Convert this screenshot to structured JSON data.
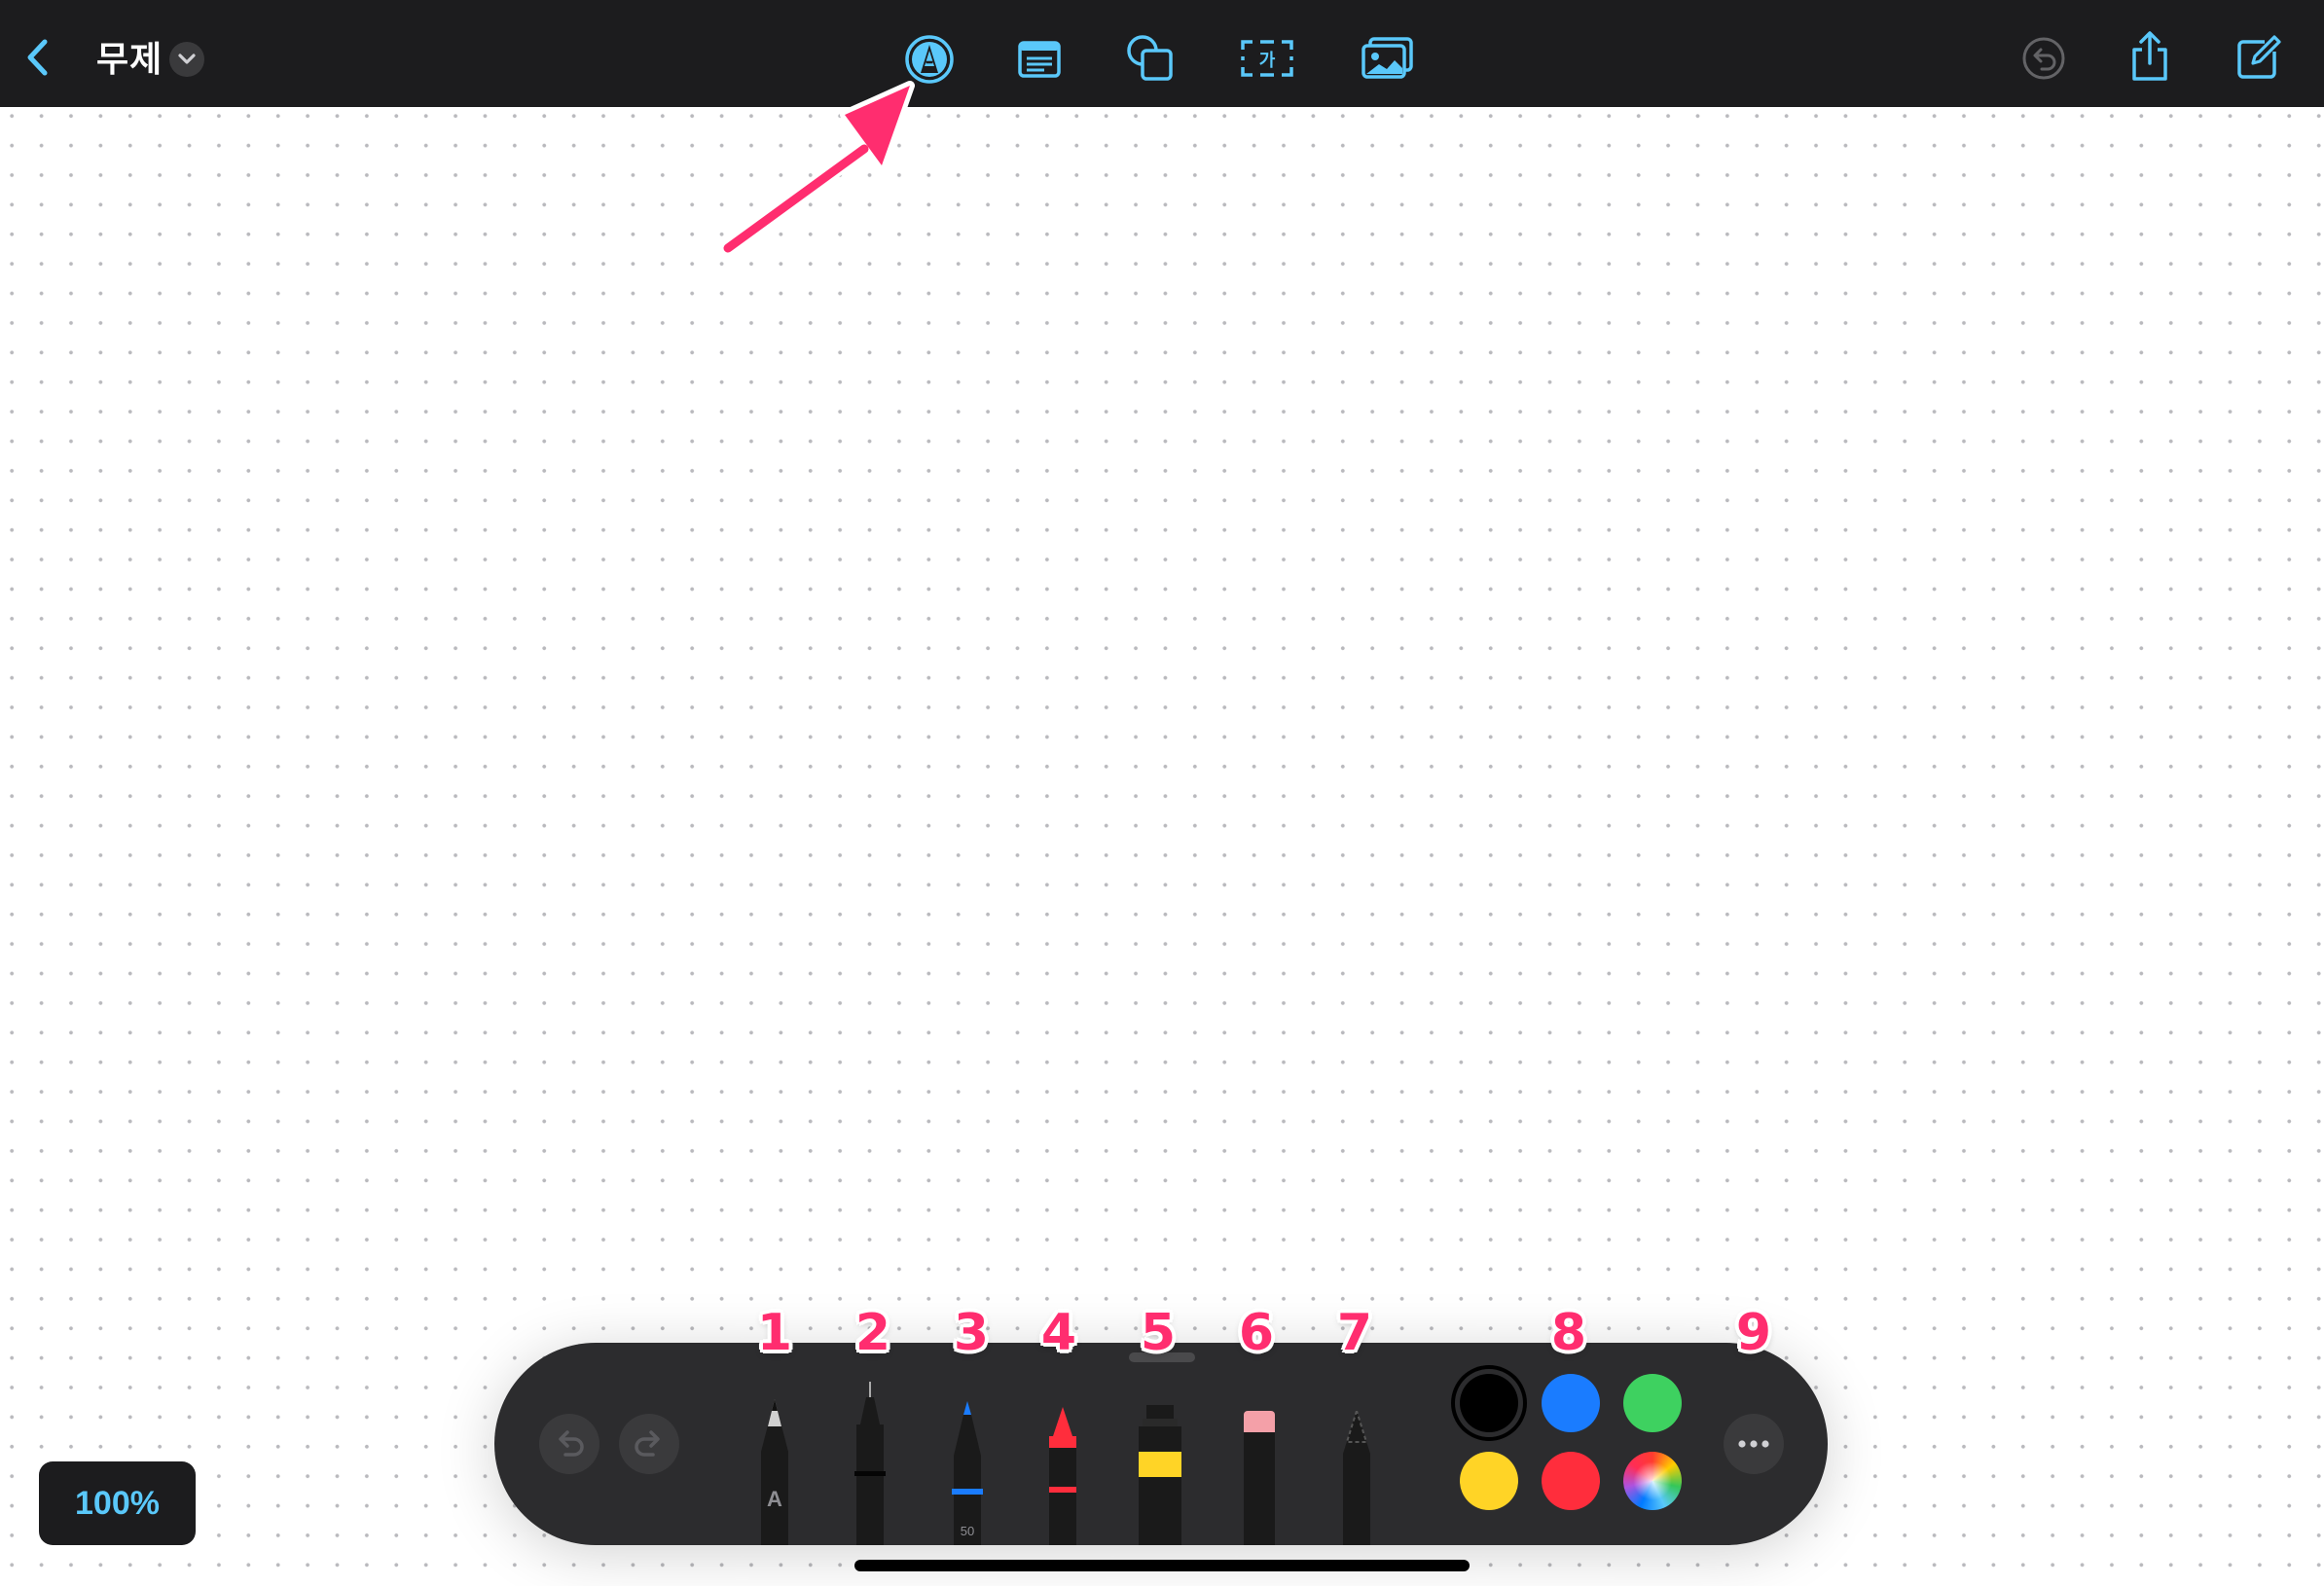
{
  "document": {
    "title": "무제"
  },
  "zoom": {
    "label": "100%"
  },
  "colors": {
    "accent": "#5ac8fa",
    "toolbar_bg": "#1c1c1e",
    "annotation": "#ff2d6f"
  },
  "toolbar": {
    "left": [
      "back-chevron-icon",
      "title-dropdown-chevron-icon"
    ],
    "center": [
      "pencil-tool-icon",
      "text-box-icon",
      "shapes-icon",
      "text-recognition-icon",
      "media-icon"
    ],
    "right": [
      "undo-icon",
      "share-icon",
      "compose-icon"
    ],
    "active_tool": "pencil-tool-icon"
  },
  "palette": {
    "buttons": [
      "undo-icon",
      "redo-icon",
      "more-options-icon"
    ],
    "tools": [
      "monoline-pen",
      "fineliner-pen",
      "marker",
      "crayon",
      "watercolor",
      "eraser",
      "lasso"
    ],
    "marker_label": "50",
    "pen_label": "A",
    "swatches": [
      {
        "name": "black",
        "color": "#000000",
        "selected": true
      },
      {
        "name": "blue",
        "color": "#1a7cff"
      },
      {
        "name": "green",
        "color": "#3ed160"
      },
      {
        "name": "yellow",
        "color": "#ffd426"
      },
      {
        "name": "red",
        "color": "#ff2d3c"
      },
      {
        "name": "multicolor",
        "color": "conic"
      }
    ]
  },
  "annotations": {
    "numbers": [
      "1",
      "2",
      "3",
      "4",
      "5",
      "6",
      "7",
      "8",
      "9"
    ]
  }
}
